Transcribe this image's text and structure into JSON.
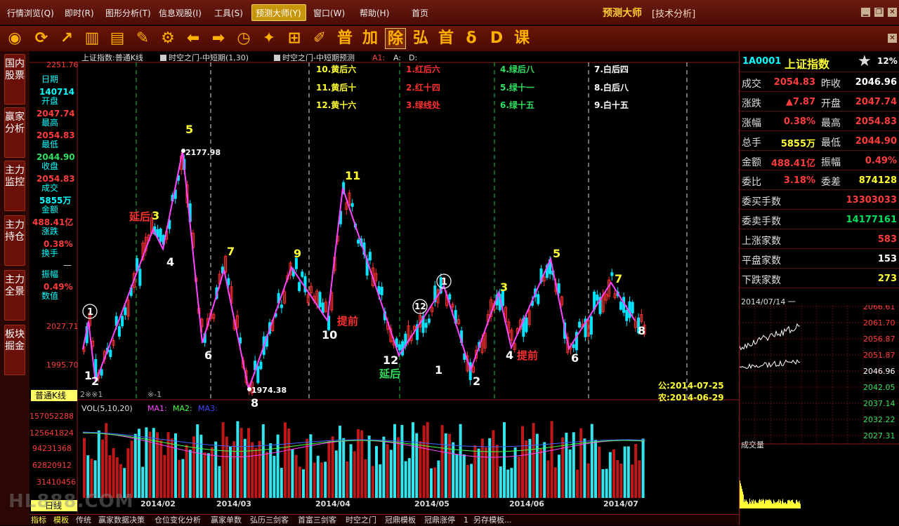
{
  "menu": {
    "items": [
      "行情浏览(Q)",
      "即时(R)",
      "图形分析(T)",
      "信息观股(I)",
      "工具(S)",
      "预测大师(Y)",
      "窗口(W)",
      "帮助(H)",
      "首页"
    ],
    "app_title": "预测大师",
    "app_sub": "[技术分析]"
  },
  "toolbar": {
    "icons": [
      "rss-icon",
      "refresh-icon",
      "line-chart-icon",
      "bar-chart-icon",
      "notes-icon",
      "pencil-icon",
      "wrench-icon",
      "arrow-left-icon",
      "arrow-right-icon",
      "clock-icon",
      "star-doc-icon",
      "add-folder-icon",
      "edit-doc-icon"
    ],
    "text_buttons": [
      "普",
      "加",
      "除",
      "弘",
      "首",
      "δ",
      "D",
      "课"
    ]
  },
  "sidebar": [
    "国内股票",
    "赢家分析",
    "主力监控",
    "主力持仓",
    "主力全景",
    "板块掘金"
  ],
  "chart_header": {
    "title": "上证指数:普通K线",
    "ind1": "时空之门-中短期(1,30)",
    "ind2": "时空之门-中短期预测",
    "ind3": "A1:",
    "ind4": "A:",
    "ind5": "D:"
  },
  "legend": {
    "col1": [
      "10.黄后六",
      "11.黄后十",
      "12.黄十六"
    ],
    "col2": [
      "1.红后六",
      "2.红十四",
      "3.绿线处"
    ],
    "col3": [
      "4.绿后八",
      "5.绿十一",
      "6.绿十五"
    ],
    "col4": [
      "7.白后四",
      "8.白后八",
      "9.白十五"
    ]
  },
  "left_info": {
    "price_top": "2251.76",
    "date_label": "日期",
    "date_value": "140714",
    "open_label": "开盘",
    "open_value": "2047.74",
    "high_label": "最高",
    "high_value": "2054.83",
    "low_label": "最低",
    "low_value": "2044.90",
    "close_label": "收盘",
    "close_value": "2054.83",
    "vol_label": "成交",
    "vol_value": "5855万",
    "amt_label": "金额",
    "amt_value": "488.41亿",
    "chg_label": "涨跌",
    "chg_value": "0.38%",
    "turn_label": "换手",
    "turn_value": "—",
    "amp_label": "振幅",
    "amp_value": "0.49%",
    "val_label": "数值",
    "price_2027": "2027.71",
    "price_1995": "1995.70"
  },
  "chart_data": {
    "type": "candlestick",
    "dates_axis": [
      "2014/02",
      "2014/03",
      "2014/04",
      "2014/05",
      "2014/06",
      "2014/07"
    ],
    "annotations": {
      "peak_high": "2177.98",
      "trough_low": "1974.38",
      "wave_numbers": [
        "1",
        "2",
        "3",
        "4",
        "5",
        "6",
        "7",
        "8",
        "9",
        "10",
        "11",
        "12",
        "1",
        "2",
        "3",
        "4",
        "5",
        "6",
        "7",
        "8"
      ],
      "circle_labels": [
        "1",
        "12",
        "1"
      ],
      "text_labels": [
        "延后",
        "提前",
        "延后",
        "提前"
      ],
      "calendar_gong": "公:2014-07-25",
      "calendar_nong": "农:2014-06-29",
      "marks": [
        "2※※1",
        "※-1"
      ]
    },
    "volume_title": "VOL(5,10,20)",
    "volume_ma": [
      "MA1:",
      "MA2:",
      "MA3:"
    ],
    "volume_axis": [
      "157052288",
      "125641824",
      "94231368",
      "62820912",
      "31410456"
    ],
    "kline_label": "普通K线",
    "day_label": "日线"
  },
  "infopanel": {
    "code": "1A0001",
    "name": "上证指数",
    "pct": "12%",
    "rows": [
      {
        "l1": "成交",
        "v1": "2054.83",
        "c1": "red",
        "l2": "昨收",
        "v2": "2046.96",
        "c2": "white"
      },
      {
        "l1": "涨跌",
        "v1": "▲7.87",
        "c1": "red",
        "l2": "开盘",
        "v2": "2047.74",
        "c2": "red"
      },
      {
        "l1": "涨幅",
        "v1": "0.38%",
        "c1": "red",
        "l2": "最高",
        "v2": "2054.83",
        "c2": "red"
      },
      {
        "l1": "总手",
        "v1": "5855万",
        "c1": "yellow",
        "l2": "最低",
        "v2": "2044.90",
        "c2": "red"
      },
      {
        "l1": "金额",
        "v1": "488.41亿",
        "c1": "red",
        "l2": "振幅",
        "v2": "0.49%",
        "c2": "red"
      },
      {
        "l1": "委比",
        "v1": "3.18%",
        "c1": "red",
        "l2": "委差",
        "v2": "874128",
        "c2": "yellow"
      }
    ],
    "single_rows": [
      {
        "l": "委买手数",
        "v": "13303033",
        "c": "red"
      },
      {
        "l": "委卖手数",
        "v": "14177161",
        "c": "green"
      },
      {
        "l": "上涨家数",
        "v": "583",
        "c": "red"
      },
      {
        "l": "平盘家数",
        "v": "153",
        "c": "white"
      },
      {
        "l": "下跌家数",
        "v": "273",
        "c": "yellow"
      }
    ],
    "mini_date": "2014/07/14 一",
    "mini_prices": [
      "2066.61",
      "2061.70",
      "2056.87",
      "2051.87",
      "2046.96",
      "2042.05",
      "2037.14",
      "2032.22",
      "2027.31"
    ],
    "mini_vol_label": "成交量"
  },
  "bottom_tabs": [
    "指标",
    "模板",
    "传统",
    "赢家数据决策",
    "仓位变化分析",
    "赢家单数",
    "弘历三剑客",
    "首富三剑客",
    "时空之门",
    "冠鼎模板",
    "冠鼎涨停",
    "1",
    "另存模板..."
  ],
  "watermark": "HL888.COM"
}
